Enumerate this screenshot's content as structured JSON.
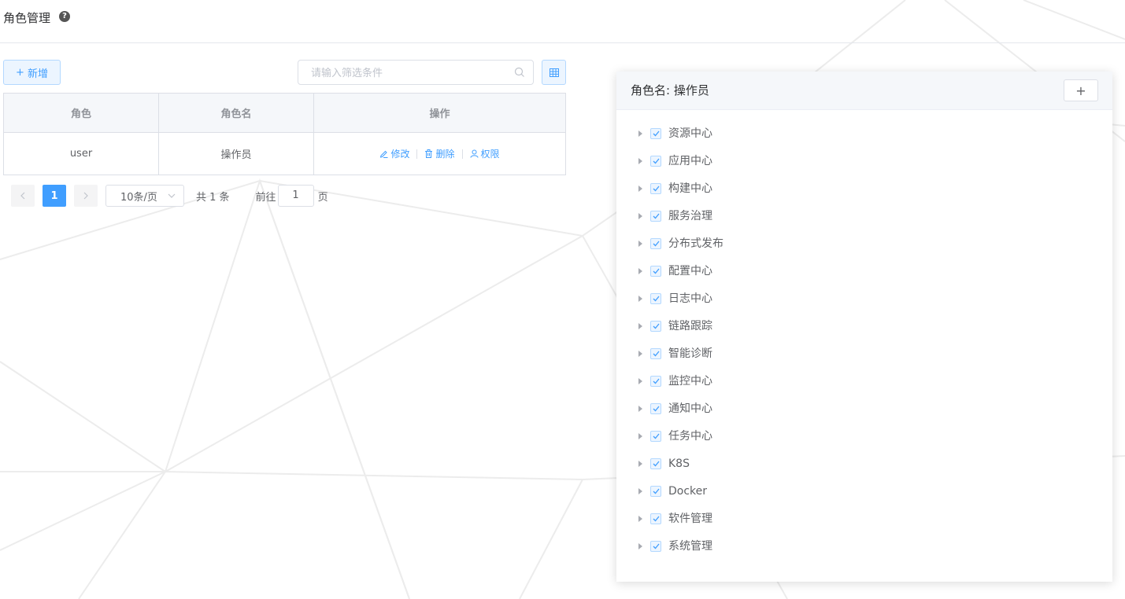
{
  "header": {
    "title": "角色管理",
    "help_icon": "question-circle-icon"
  },
  "toolbar": {
    "add_label": "新增",
    "search_placeholder": "请输入筛选条件",
    "search_value": ""
  },
  "table": {
    "columns": [
      "角色",
      "角色名",
      "操作"
    ],
    "rows": [
      {
        "role": "user",
        "role_name": "操作员",
        "actions": [
          "修改",
          "删除",
          "权限"
        ]
      }
    ]
  },
  "pagination": {
    "current_page": "1",
    "page_size": "10条/页",
    "total_text": "共 1 条",
    "goto_label": "前往",
    "goto_value": "1",
    "goto_suffix": "页"
  },
  "permission_panel": {
    "title": "角色名: 操作员",
    "add_label": "+",
    "nodes": [
      {
        "label": "资源中心",
        "checked": true
      },
      {
        "label": "应用中心",
        "checked": true
      },
      {
        "label": "构建中心",
        "checked": true
      },
      {
        "label": "服务治理",
        "checked": true
      },
      {
        "label": "分布式发布",
        "checked": true
      },
      {
        "label": "配置中心",
        "checked": true
      },
      {
        "label": "日志中心",
        "checked": true
      },
      {
        "label": "链路跟踪",
        "checked": true
      },
      {
        "label": "智能诊断",
        "checked": true
      },
      {
        "label": "监控中心",
        "checked": true
      },
      {
        "label": "通知中心",
        "checked": true
      },
      {
        "label": "任务中心",
        "checked": true
      },
      {
        "label": "K8S",
        "checked": true
      },
      {
        "label": "Docker",
        "checked": true
      },
      {
        "label": "软件管理",
        "checked": true
      },
      {
        "label": "系统管理",
        "checked": true
      }
    ]
  },
  "colors": {
    "primary": "#409eff",
    "primary_light": "#ecf5ff",
    "border": "#dcdfe6"
  }
}
